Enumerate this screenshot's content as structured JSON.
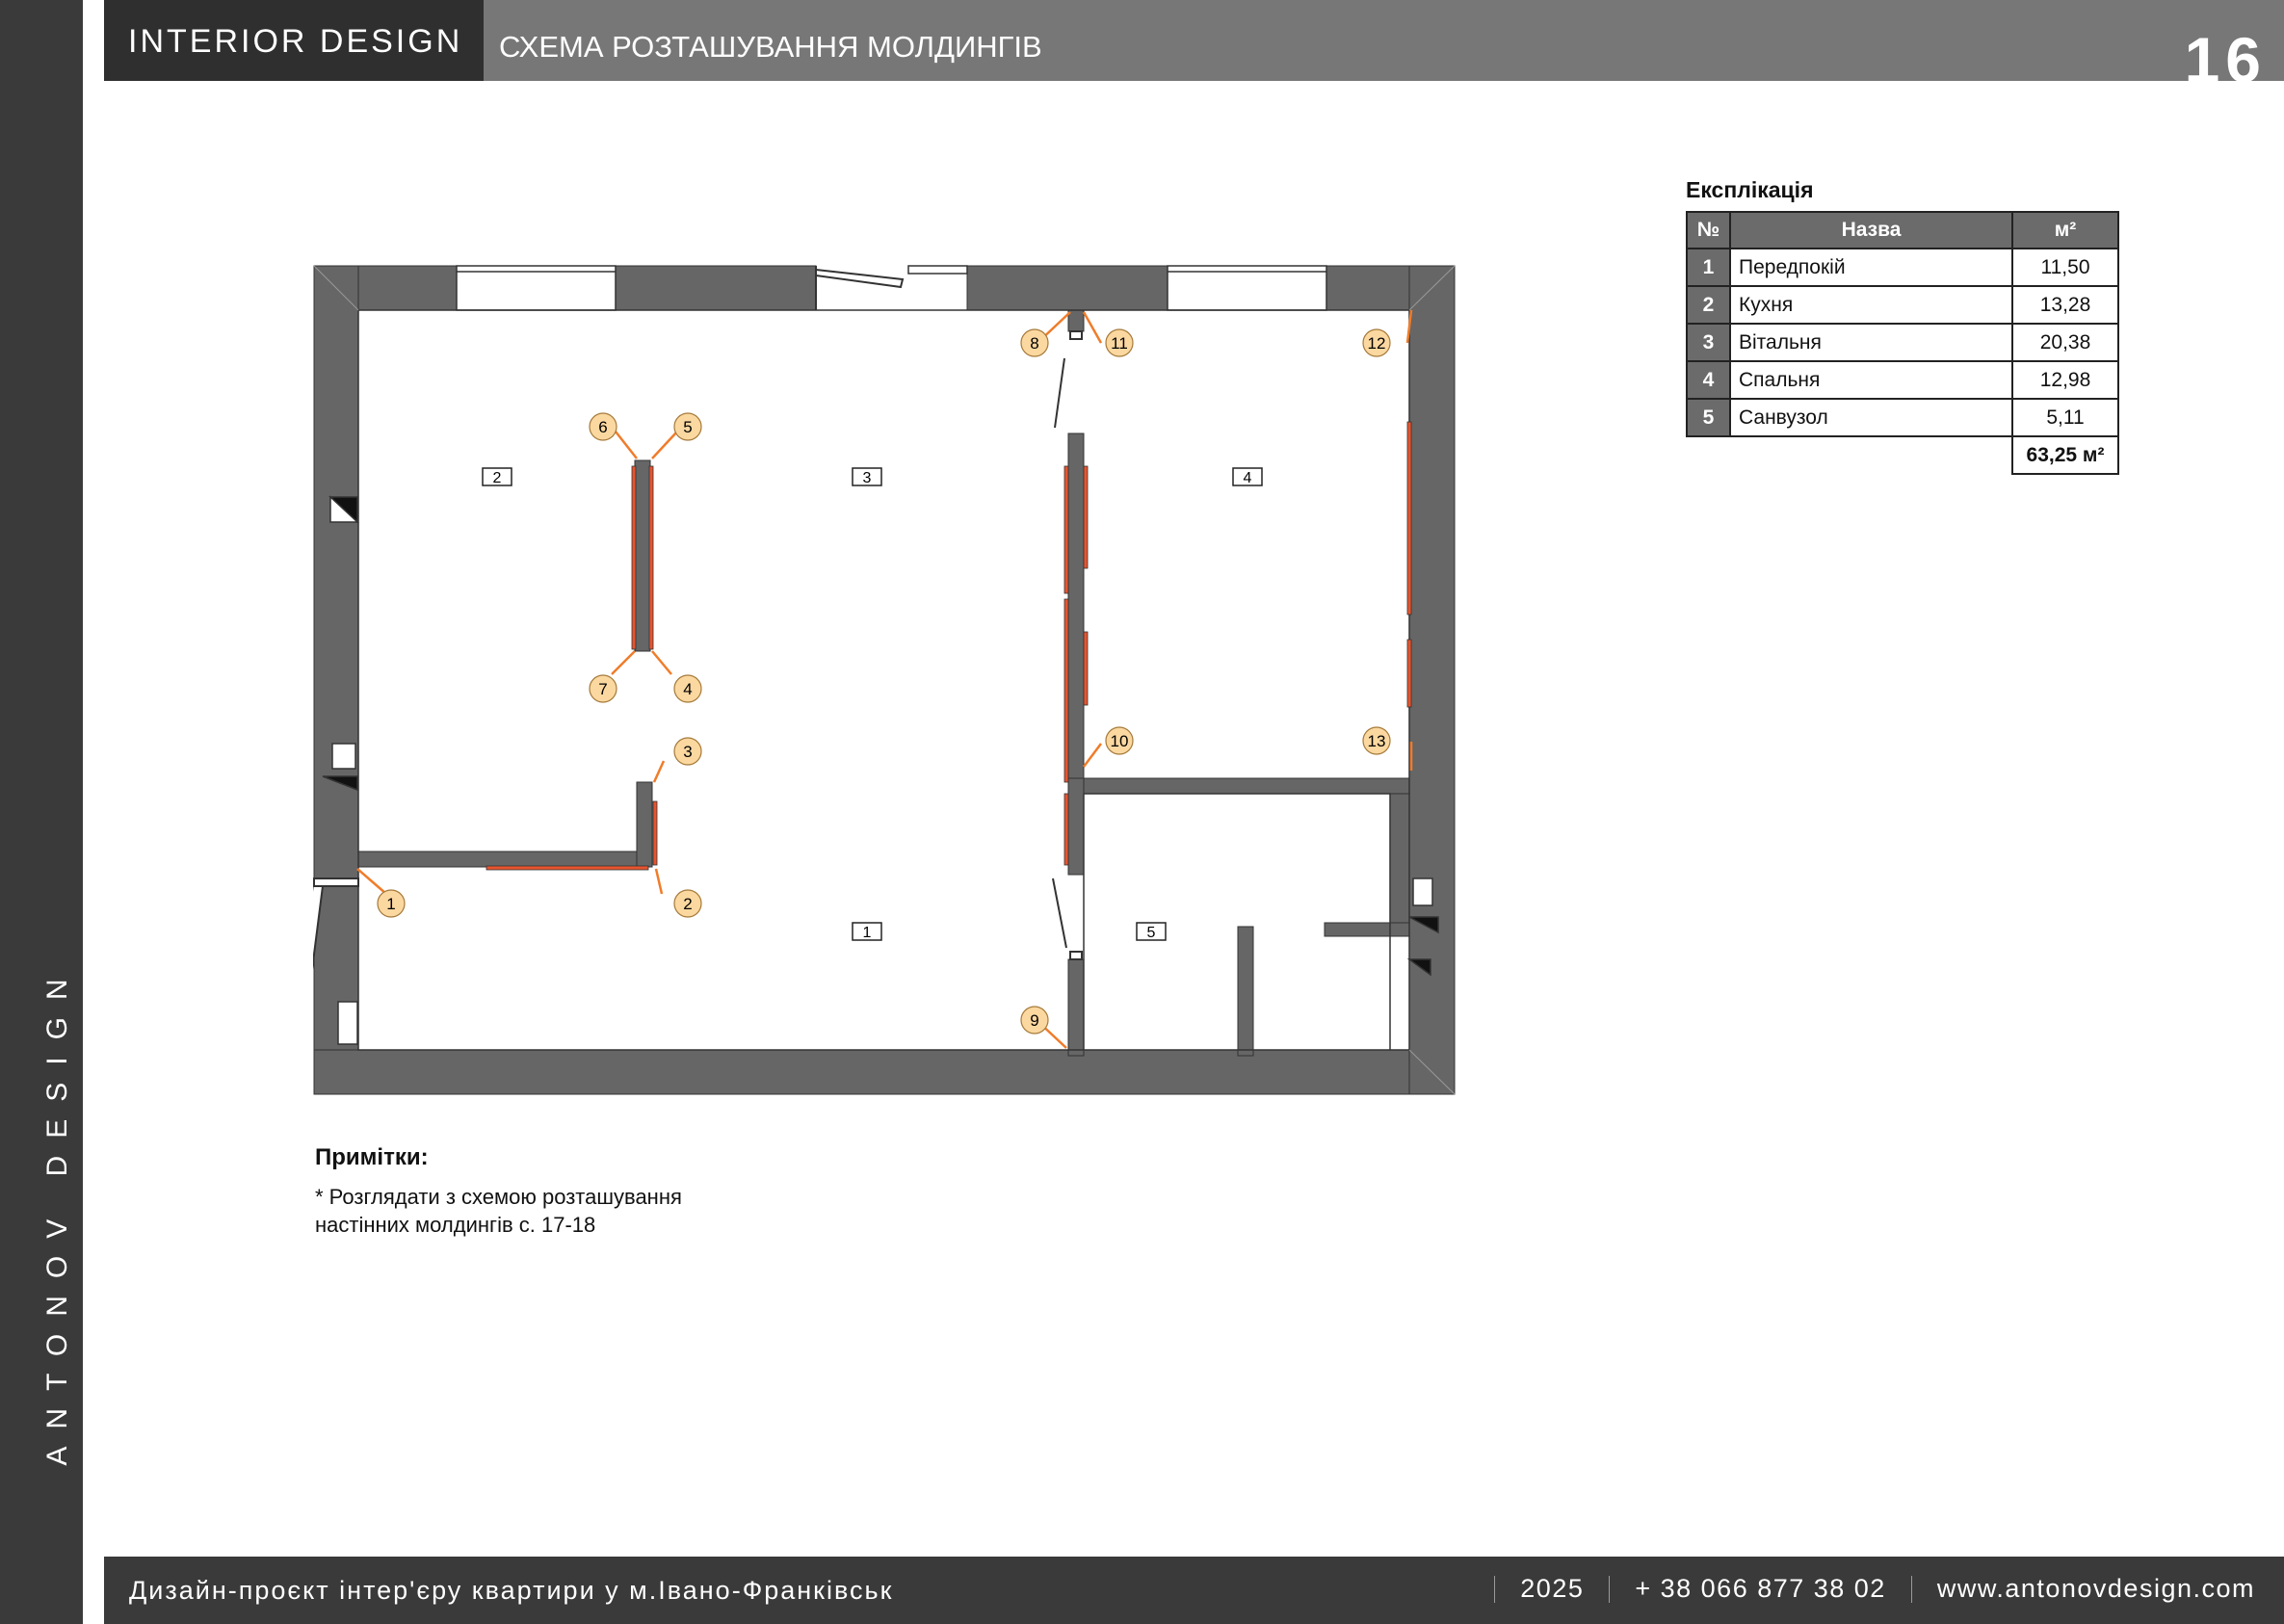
{
  "header": {
    "brand": "INTERIOR  DESIGN",
    "title": "СХЕМА РОЗТАШУВАННЯ МОЛДИНГІВ",
    "page_number": "16"
  },
  "side_brand": "ANTONOV DESIGN",
  "plan": {
    "room_tags": [
      "2",
      "3",
      "4",
      "1",
      "5"
    ],
    "markers": [
      "1",
      "2",
      "3",
      "4",
      "5",
      "6",
      "7",
      "8",
      "9",
      "10",
      "11",
      "12",
      "13"
    ],
    "colors": {
      "wall": "#666666",
      "molding": "#e8542e",
      "arrow": "#f07c2a",
      "marker_fill": "#fbd8a0"
    }
  },
  "legend": {
    "title": "Експлікація",
    "headers": {
      "no": "№",
      "name": "Назва",
      "area": "м²"
    },
    "rows": [
      {
        "no": "1",
        "name": "Передпокій",
        "area": "11,50"
      },
      {
        "no": "2",
        "name": "Кухня",
        "area": "13,28"
      },
      {
        "no": "3",
        "name": "Вітальня",
        "area": "20,38"
      },
      {
        "no": "4",
        "name": "Спальня",
        "area": "12,98"
      },
      {
        "no": "5",
        "name": "Санвузол",
        "area": "5,11"
      }
    ],
    "total": "63,25 м²"
  },
  "notes": {
    "title": "Примітки:",
    "text": "* Розглядати з схемою розташування настінних молдингів с. 17-18"
  },
  "footer": {
    "project": "Дизайн-проєкт інтер'єру квартири у м.Івано-Франківськ",
    "year": "2025",
    "phone": "+ 38 066 877 38 02",
    "website": "www.antonovdesign.com"
  }
}
